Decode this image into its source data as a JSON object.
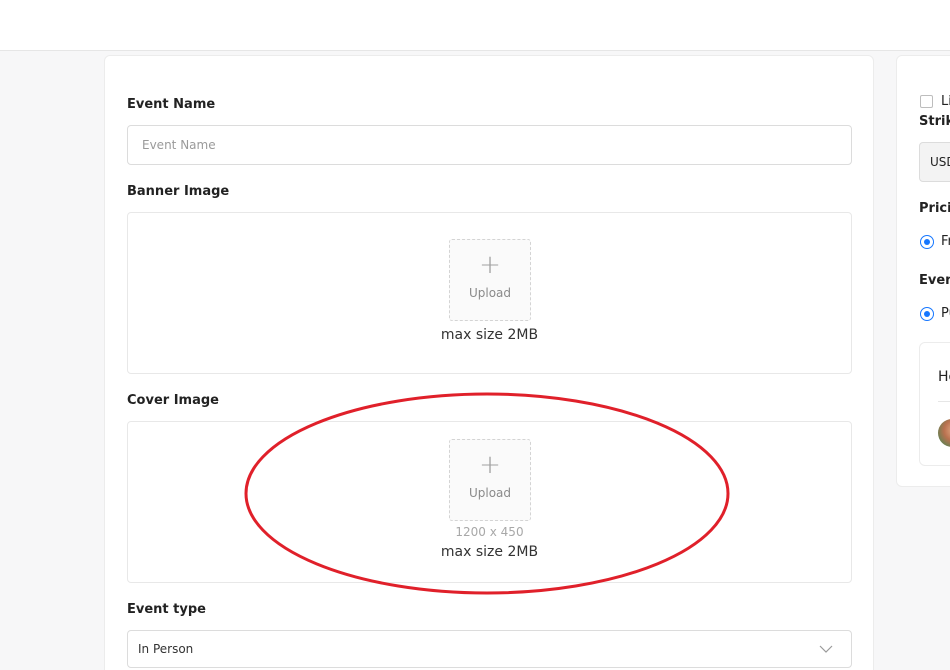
{
  "form": {
    "event_name": {
      "label": "Event Name",
      "placeholder": "Event Name",
      "value": ""
    },
    "banner_image": {
      "label": "Banner Image",
      "upload_label": "Upload",
      "plus": "+",
      "max_size": "max size 2MB"
    },
    "cover_image": {
      "label": "Cover Image",
      "upload_label": "Upload",
      "plus": "+",
      "dimensions": "1200 x 450",
      "max_size": "max size 2MB"
    },
    "event_type": {
      "label": "Event type",
      "selected": "In Person"
    }
  },
  "side_panel": {
    "checkbox_label": "Li",
    "strike_label": "Strike",
    "currency_value": "USD",
    "pricing_label": "Pricin",
    "pricing_option": "Fr",
    "event_label": "Even",
    "event_option": "Pu",
    "host_title": "Ho"
  },
  "annotation": {
    "color": "#e0202a"
  },
  "colors": {
    "accent": "#1677ff"
  }
}
